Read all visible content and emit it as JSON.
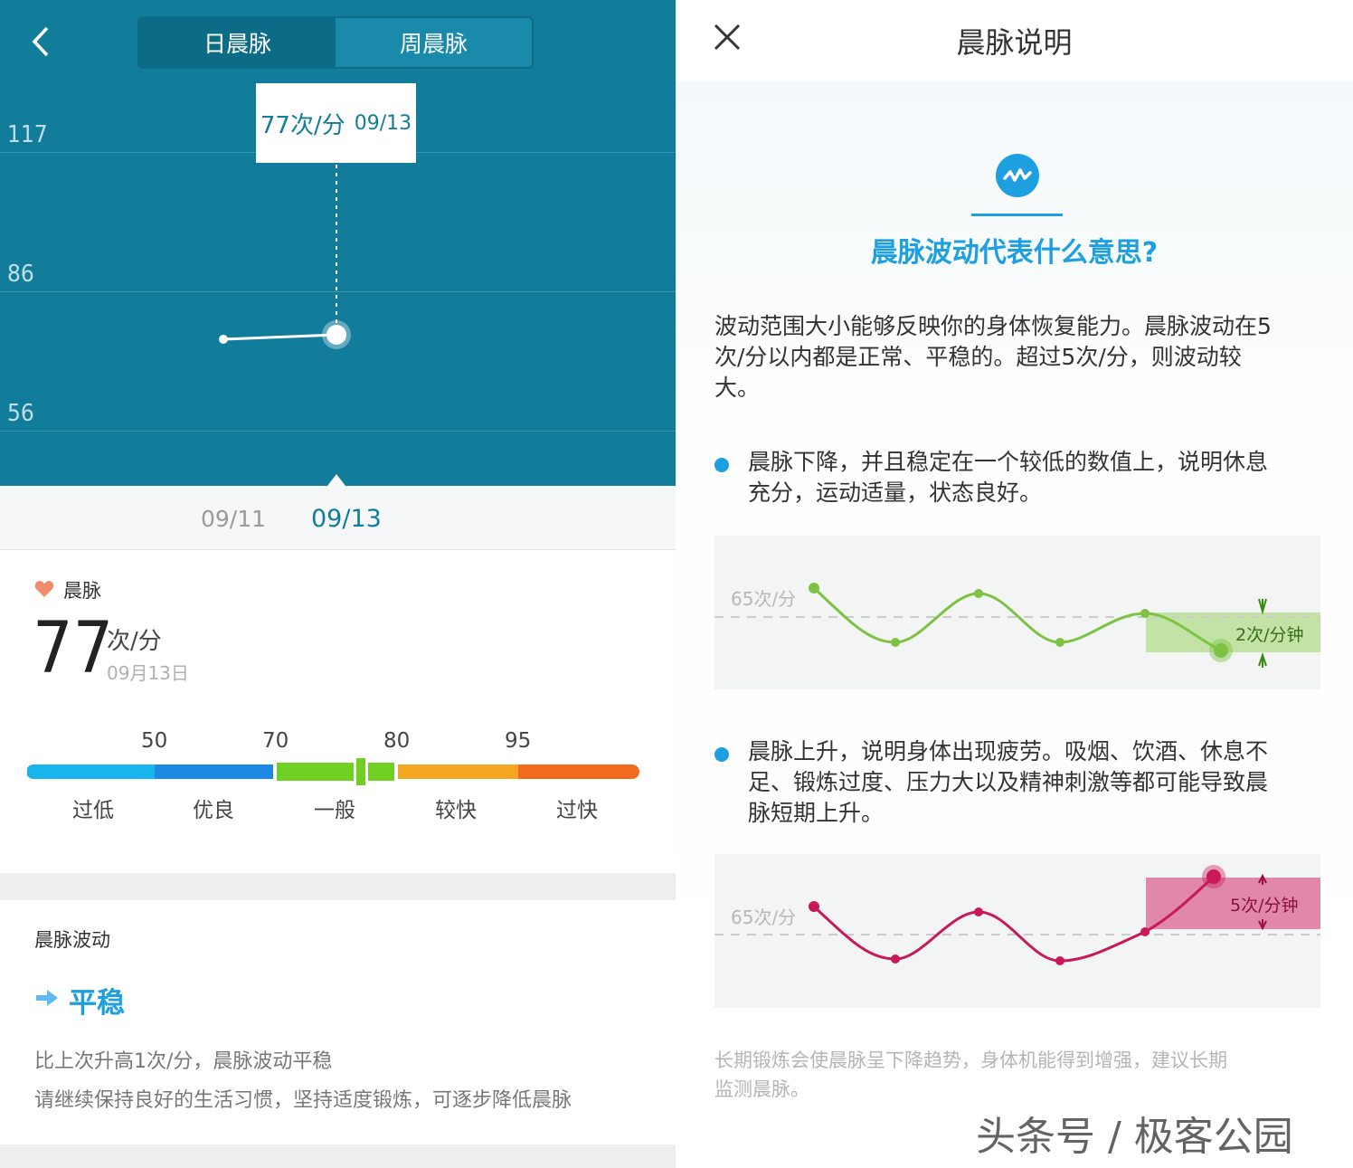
{
  "left_panel": {
    "header": {
      "tabs": [
        {
          "label": "日晨脉",
          "active": true
        },
        {
          "label": "周晨脉",
          "active": false
        }
      ]
    },
    "chart": {
      "y_ticks": [
        "117",
        "86",
        "56"
      ],
      "tooltip": {
        "value": "77次/分",
        "date": "09/13"
      },
      "dates": [
        "09/11",
        "09/13"
      ],
      "selected_date": "09/13"
    },
    "pulse": {
      "label": "晨脉",
      "value": "77",
      "unit": "次/分",
      "date": "09月13日"
    },
    "scale": {
      "thresholds": [
        "50",
        "70",
        "80",
        "95"
      ],
      "categories": [
        "过低",
        "优良",
        "一般",
        "较快",
        "过快"
      ],
      "colors": [
        "#18b4ec",
        "#1e88e5",
        "#6fcf22",
        "#f5a623",
        "#f26b1d"
      ],
      "marker_value": 77
    },
    "fluctuation": {
      "title": "晨脉波动",
      "status": "平稳",
      "line1": "比上次升高1次/分，晨脉波动平稳",
      "line2": "请继续保持良好的生活习惯，坚持适度锻炼，可逐步降低晨脉"
    }
  },
  "right_panel": {
    "title": "晨脉说明",
    "question": "晨脉波动代表什么意思?",
    "intro": [
      "波动范围大小能够反映你的身体恢复能力。晨脉波动在5",
      "次/分以内都是正常、平稳的。超过5次/分，则波动较",
      "大。"
    ],
    "bullet1": [
      "晨脉下降，并且稳定在一个较低的数值上，说明休息",
      "充分，运动适量，状态良好。"
    ],
    "chart1": {
      "baseline": "65次/分",
      "range": "2次/分钟",
      "color": "#7dc242"
    },
    "bullet2": [
      "晨脉上升，说明身体出现疲劳。吸烟、饮酒、休息不",
      "足、锻炼过度、压力大以及精神刺激等都可能导致晨",
      "脉短期上升。"
    ],
    "chart2": {
      "baseline": "65次/分",
      "range": "5次/分钟",
      "color": "#c8195a"
    },
    "footer": [
      "长期锻炼会使晨脉呈下降趋势，身体机能得到增强，建议长期",
      "监测晨脉。"
    ],
    "watermark": "头条号 / 极客公园"
  },
  "colors": {
    "teal": "#117d9b",
    "accent_blue": "#1e9fe0"
  }
}
